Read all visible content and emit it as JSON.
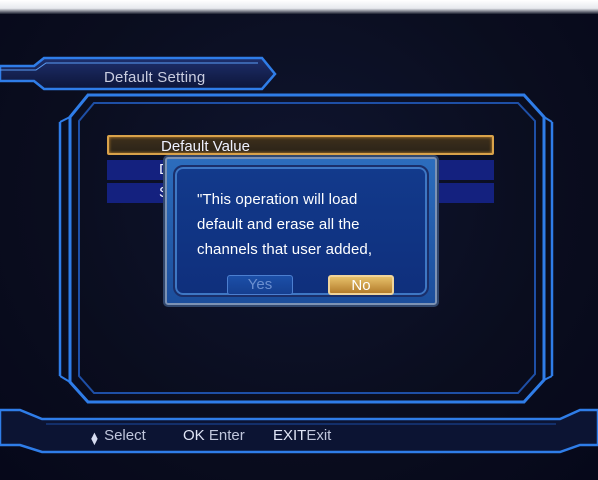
{
  "screen": {
    "title": "Default Setting"
  },
  "menu": {
    "items": [
      {
        "label": "Default Value",
        "selected": true
      },
      {
        "label": "D",
        "selected": false
      },
      {
        "label": "S",
        "selected": false
      }
    ]
  },
  "dialog": {
    "lines": [
      "\"This operation will load",
      "default and erase all the",
      "channels that user added,"
    ],
    "yes_label": "Yes",
    "no_label": "No",
    "focused_button": "No"
  },
  "help_bar": {
    "select_icon": "up-down-arrow-icon",
    "select_label": "Select",
    "ok_key": "OK",
    "ok_label": "Enter",
    "exit_key": "EXIT",
    "exit_label": "Exit"
  },
  "colors": {
    "frame": "#2f7de8",
    "highlight_border": "#d9a24a",
    "row_background": "#14217f",
    "dialog_background": "#123a8c"
  }
}
